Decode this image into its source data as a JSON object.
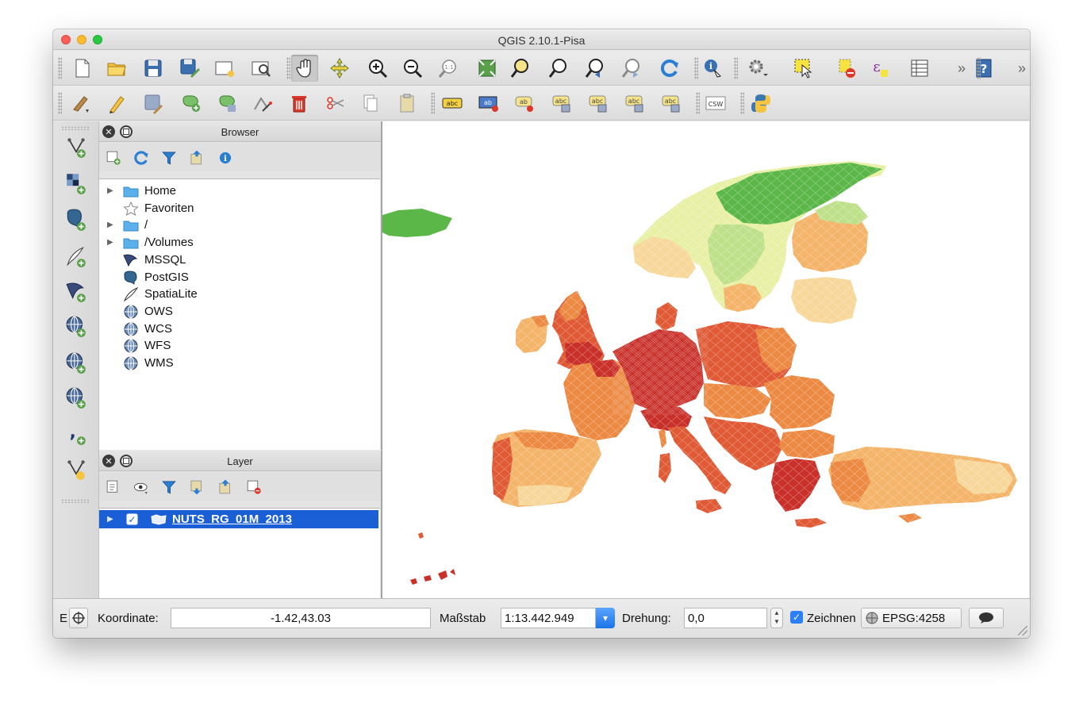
{
  "window": {
    "title": "QGIS 2.10.1-Pisa"
  },
  "toolbar_main": [
    {
      "icon": "new-project-icon",
      "tip": "New project"
    },
    {
      "icon": "open-project-icon",
      "tip": "Open project"
    },
    {
      "icon": "save-project-icon",
      "tip": "Save project"
    },
    {
      "icon": "save-as-icon",
      "tip": "Save as"
    },
    {
      "icon": "new-print-composer-icon",
      "tip": "New print composer"
    },
    {
      "icon": "composer-manager-icon",
      "tip": "Composer manager"
    },
    {
      "icon": "pan-hand-icon",
      "tip": "Pan map",
      "active": true
    },
    {
      "icon": "pan-to-selection-icon",
      "tip": "Pan to selection"
    },
    {
      "icon": "zoom-in-icon",
      "tip": "Zoom in"
    },
    {
      "icon": "zoom-out-icon",
      "tip": "Zoom out"
    },
    {
      "icon": "zoom-actual-size-icon",
      "tip": "Zoom to native resolution"
    },
    {
      "icon": "zoom-full-icon",
      "tip": "Zoom full"
    },
    {
      "icon": "zoom-to-selection-icon",
      "tip": "Zoom to selection"
    },
    {
      "icon": "zoom-to-layer-icon",
      "tip": "Zoom to layer"
    },
    {
      "icon": "zoom-last-icon",
      "tip": "Zoom last"
    },
    {
      "icon": "zoom-next-icon",
      "tip": "Zoom next"
    },
    {
      "icon": "refresh-icon",
      "tip": "Refresh"
    },
    {
      "icon": "identify-icon",
      "tip": "Identify features"
    },
    {
      "icon": "measure-icon",
      "tip": "Measure"
    },
    {
      "icon": "select-features-icon",
      "tip": "Select features"
    },
    {
      "icon": "deselect-icon",
      "tip": "Deselect"
    },
    {
      "icon": "expression-select-icon",
      "tip": "Select by expression"
    },
    {
      "icon": "attribute-table-icon",
      "tip": "Open attribute table"
    },
    {
      "icon": "help-icon",
      "tip": "Help"
    }
  ],
  "toolbar_edit": [
    {
      "icon": "current-edits-icon"
    },
    {
      "icon": "toggle-editing-icon"
    },
    {
      "icon": "save-edits-icon"
    },
    {
      "icon": "add-feature-icon"
    },
    {
      "icon": "move-feature-icon"
    },
    {
      "icon": "node-tool-icon"
    },
    {
      "icon": "delete-selected-icon"
    },
    {
      "icon": "cut-features-icon"
    },
    {
      "icon": "copy-features-icon"
    },
    {
      "icon": "paste-features-icon"
    },
    {
      "icon": "label-icon",
      "text": "abc"
    },
    {
      "icon": "label-pin-icon",
      "text": "ab"
    },
    {
      "icon": "label-highlight-icon",
      "text": "ab"
    },
    {
      "icon": "label-show-hide-icon",
      "text": "abc"
    },
    {
      "icon": "label-move-icon",
      "text": "abc"
    },
    {
      "icon": "label-rotate-icon",
      "text": "abc"
    },
    {
      "icon": "label-change-icon",
      "text": "abc"
    },
    {
      "icon": "csw-icon",
      "text": "CSW"
    },
    {
      "icon": "python-icon"
    }
  ],
  "side_toolbar": [
    "add-vector-layer-icon",
    "add-raster-layer-icon",
    "add-postgis-layer-icon",
    "add-spatialite-layer-icon",
    "add-mssql-layer-icon",
    "add-wms-layer-icon",
    "add-wcs-layer-icon",
    "add-wfs-layer-icon",
    "add-delimited-text-layer-icon",
    "new-shapefile-layer-icon"
  ],
  "browser": {
    "title": "Browser",
    "tools": [
      "add-selected-icon",
      "refresh-icon",
      "filter-icon",
      "collapse-all-icon",
      "properties-icon"
    ],
    "items": [
      {
        "label": "Home",
        "icon": "folder-icon",
        "expandable": true
      },
      {
        "label": "Favoriten",
        "icon": "star-icon",
        "expandable": false
      },
      {
        "label": "/",
        "icon": "folder-icon",
        "expandable": true
      },
      {
        "label": "/Volumes",
        "icon": "folder-icon",
        "expandable": true
      },
      {
        "label": "MSSQL",
        "icon": "mssql-icon",
        "expandable": false
      },
      {
        "label": "PostGIS",
        "icon": "postgis-elephant-icon",
        "expandable": false
      },
      {
        "label": "SpatiaLite",
        "icon": "spatialite-feather-icon",
        "expandable": false
      },
      {
        "label": "OWS",
        "icon": "ows-globe-icon",
        "expandable": false
      },
      {
        "label": "WCS",
        "icon": "wcs-globe-icon",
        "expandable": false
      },
      {
        "label": "WFS",
        "icon": "wfs-globe-icon",
        "expandable": false
      },
      {
        "label": "WMS",
        "icon": "wms-globe-icon",
        "expandable": false
      }
    ]
  },
  "layers": {
    "title": "Layer",
    "tools": [
      "open-layer-styling-icon",
      "visibility-menu-icon",
      "filter-legend-icon",
      "expand-all-icon",
      "collapse-all-icon",
      "remove-layer-icon"
    ],
    "items": [
      {
        "name": "NUTS_RG_01M_2013",
        "checked": true,
        "selected": true,
        "icon": "polygon-layer-icon"
      }
    ]
  },
  "map": {
    "colors": {
      "darkest": "#c9302a",
      "dark": "#df5a35",
      "mid": "#ec8a44",
      "light": "#f4b46a",
      "pale": "#f7d79a",
      "yellowgreen": "#e8f0a6",
      "lightgreen": "#bfe08a",
      "green": "#5cb749"
    }
  },
  "statusbar": {
    "coord_label": "Koordinate:",
    "coord_value": "-1.42,43.03",
    "scale_label": "Maßstab",
    "scale_value": "1:13.442.949",
    "rotation_label": "Drehung:",
    "rotation_value": "0,0",
    "render_label": "Zeichnen",
    "render_checked": true,
    "crs_label": "EPSG:4258",
    "left_letter": "E"
  }
}
